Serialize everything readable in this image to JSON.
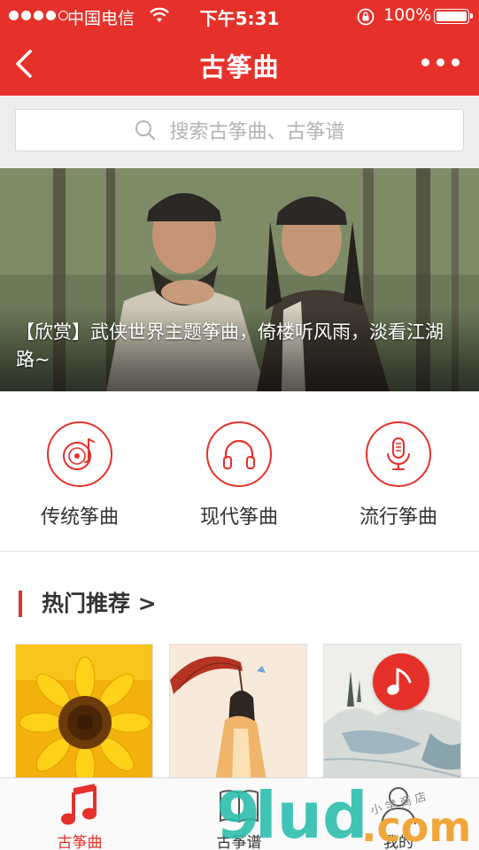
{
  "status_bar": {
    "carrier": "中国电信",
    "time": "下午5:31",
    "battery": "100%"
  },
  "nav": {
    "title": "古筝曲"
  },
  "search": {
    "placeholder": "搜索古筝曲、古筝谱"
  },
  "banner": {
    "caption": "【欣赏】武侠世界主题筝曲，倚楼听风雨，淡看江湖路~"
  },
  "categories": [
    {
      "label": "传统筝曲",
      "icon": "vinyl-record-icon"
    },
    {
      "label": "现代筝曲",
      "icon": "headphones-icon"
    },
    {
      "label": "流行筝曲",
      "icon": "microphone-icon"
    }
  ],
  "hot": {
    "title": "热门推荐 >",
    "items": [
      {
        "image": "sunflower"
      },
      {
        "image": "lady-with-umbrella"
      },
      {
        "image": "ink-landscape",
        "badge_icon": "music-note-icon"
      }
    ]
  },
  "tabs": [
    {
      "label": "古筝曲",
      "icon": "music-note-icon",
      "active": true
    },
    {
      "label": "古筝谱",
      "icon": "book-icon",
      "active": false
    },
    {
      "label": "我的",
      "icon": "user-icon",
      "active": false
    }
  ],
  "watermark": {
    "text": "9lud.com",
    "script": "小 学 商 店"
  },
  "colors": {
    "accent": "#e5312a",
    "background": "#ededed",
    "text": "#333333"
  }
}
